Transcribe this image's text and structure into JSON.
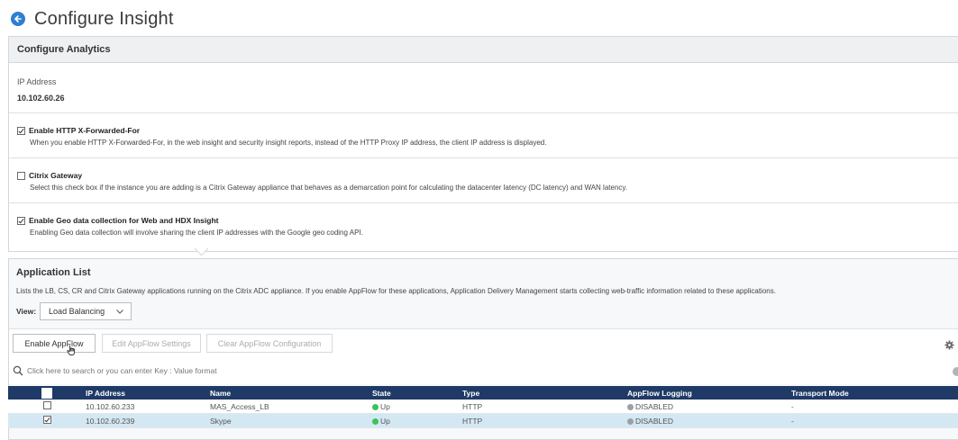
{
  "page": {
    "title": "Configure Insight"
  },
  "analytics": {
    "heading": "Configure Analytics",
    "ip_label": "IP Address",
    "ip_value": "10.102.60.26",
    "options": [
      {
        "label": "Enable HTTP X-Forwarded-For",
        "checked": true,
        "description": "When you enable HTTP X-Forwarded-For, in the web insight and security insight reports, instead of the HTTP Proxy IP address, the client IP address is displayed."
      },
      {
        "label": "Citrix Gateway",
        "checked": false,
        "description": "Select this check box if the instance you are adding is a Citrix Gateway appliance that behaves as a demarcation point for calculating the datacenter latency (DC latency) and WAN latency."
      },
      {
        "label": "Enable Geo data collection for Web and HDX Insight",
        "checked": true,
        "description": "Enabling Geo data collection will involve sharing the client IP addresses with the Google geo coding API."
      }
    ]
  },
  "app_list": {
    "heading": "Application List",
    "description": "Lists the LB, CS, CR and Citrix Gateway applications running on the Citrix ADC appliance. If you enable AppFlow for these applications, Application Delivery Management starts collecting web-traffic information related to these applications.",
    "view_label": "View:",
    "view_value": "Load Balancing",
    "buttons": {
      "enable": "Enable AppFlow",
      "edit": "Edit AppFlow Settings",
      "clear": "Clear AppFlow Configuration"
    },
    "search_placeholder": "Click here to search or you can enter Key : Value format",
    "columns": [
      "IP Address",
      "Name",
      "State",
      "Type",
      "AppFlow Logging",
      "Transport Mode"
    ],
    "rows": [
      {
        "checked": false,
        "ip": "10.102.60.233",
        "name": "MAS_Access_LB",
        "state": "Up",
        "type": "HTTP",
        "logging": "DISABLED",
        "transport": "-"
      },
      {
        "checked": true,
        "ip": "10.102.60.239",
        "name": "Skype",
        "state": "Up",
        "type": "HTTP",
        "logging": "DISABLED",
        "transport": "-"
      }
    ]
  },
  "colors": {
    "accent": "#2f7fd0",
    "table_header": "#1f3a66",
    "selected_row": "#d4e8f3",
    "status_up": "#3cc25a",
    "status_disabled": "#9c9fa3"
  },
  "icons": [
    "back-arrow-icon",
    "search-icon",
    "gear-icon",
    "chevron-down-icon",
    "checkmark-icon",
    "pointer-cursor-icon"
  ]
}
